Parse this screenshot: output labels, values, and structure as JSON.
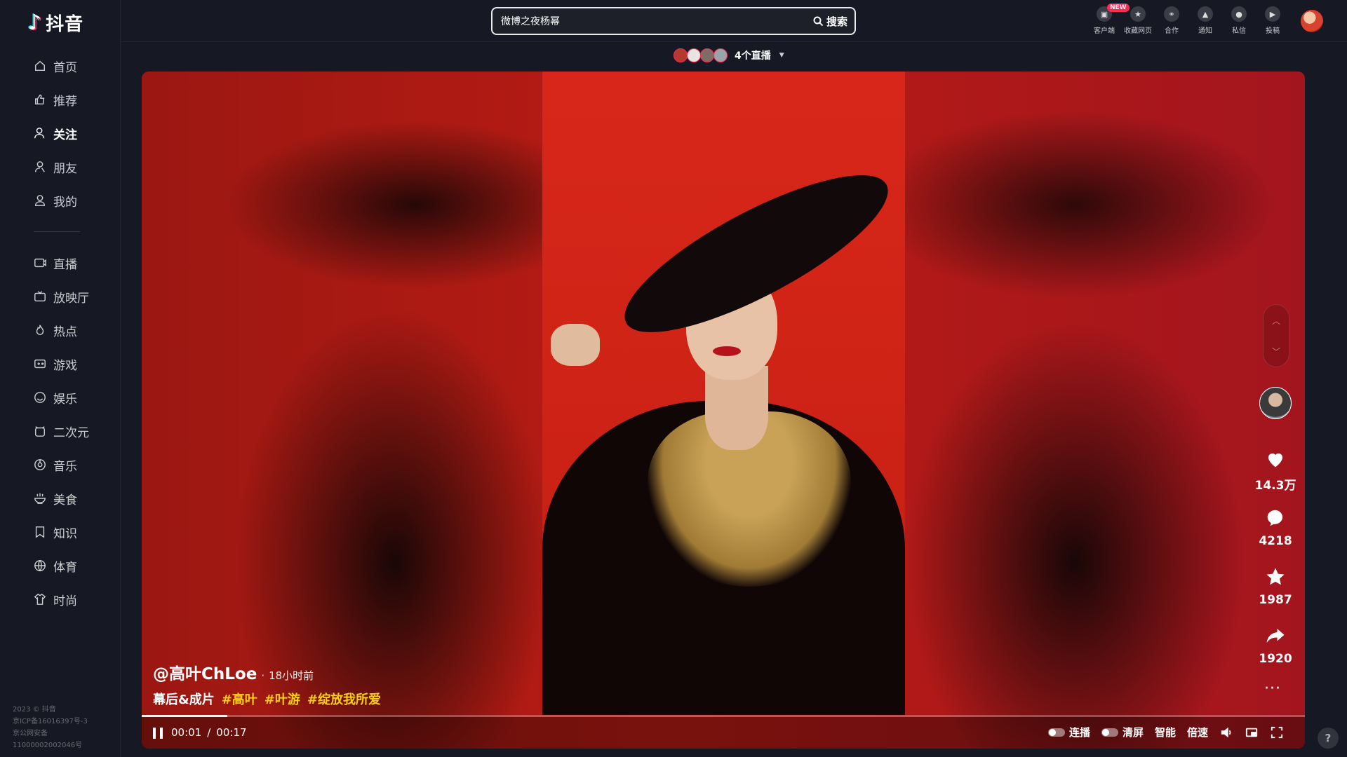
{
  "app": {
    "logo_mark": "♪",
    "logo_name": "抖音"
  },
  "nav": {
    "items": [
      {
        "label": "首页",
        "icon": "home-icon"
      },
      {
        "label": "推荐",
        "icon": "thumb-up-icon"
      },
      {
        "label": "关注",
        "icon": "user-follow-icon",
        "active": true
      },
      {
        "label": "朋友",
        "icon": "friends-icon"
      },
      {
        "label": "我的",
        "icon": "user-icon"
      }
    ],
    "items2": [
      {
        "label": "直播",
        "icon": "live-icon"
      },
      {
        "label": "放映厅",
        "icon": "tv-icon"
      },
      {
        "label": "热点",
        "icon": "flame-icon"
      },
      {
        "label": "游戏",
        "icon": "gamepad-icon"
      },
      {
        "label": "娱乐",
        "icon": "smile-icon"
      },
      {
        "label": "二次元",
        "icon": "alarm-icon"
      },
      {
        "label": "音乐",
        "icon": "music-icon"
      },
      {
        "label": "美食",
        "icon": "bowl-icon"
      },
      {
        "label": "知识",
        "icon": "bookmark-icon"
      },
      {
        "label": "体育",
        "icon": "ball-icon"
      },
      {
        "label": "时尚",
        "icon": "shirt-icon"
      }
    ]
  },
  "footer": {
    "line1": "2023 © 抖音",
    "line2": "京ICP备16016397号-3",
    "line3": "京公网安备",
    "line4": "11000002002046号"
  },
  "search": {
    "value": "微博之夜杨幂",
    "button": "搜索"
  },
  "toolbar": {
    "items": [
      {
        "label": "客户端",
        "icon": "desktop-icon",
        "badge": "NEW"
      },
      {
        "label": "收藏网页",
        "icon": "star-icon"
      },
      {
        "label": "合作",
        "icon": "handshake-icon"
      },
      {
        "label": "通知",
        "icon": "bell-icon"
      },
      {
        "label": "私信",
        "icon": "message-icon"
      },
      {
        "label": "投稿",
        "icon": "upload-icon"
      }
    ]
  },
  "live": {
    "label": "4个直播",
    "avatar_colors": [
      "#b33a2e",
      "#e9e4e0",
      "#7d6d64",
      "#9aa3a8"
    ]
  },
  "video": {
    "author": "@高叶ChLoe",
    "separator": "·",
    "time_ago": "18小时前",
    "desc": "幕后&成片",
    "tags": [
      "#高叶",
      "#叶游",
      "#绽放我所爱"
    ],
    "progress_fraction": 0.0735
  },
  "actions": {
    "likes": "14.3万",
    "comments": "4218",
    "favorites": "1987",
    "shares": "1920",
    "more": "···"
  },
  "controls": {
    "current_time": "00:01",
    "time_separator": "/",
    "duration": "00:17",
    "autoplay_label": "连播",
    "clear_label": "清屏",
    "quality_label": "智能",
    "speed_label": "倍速"
  },
  "help": "?",
  "colors": {
    "accent": "#fe2c55",
    "tag": "#face15",
    "bg": "#161823"
  }
}
